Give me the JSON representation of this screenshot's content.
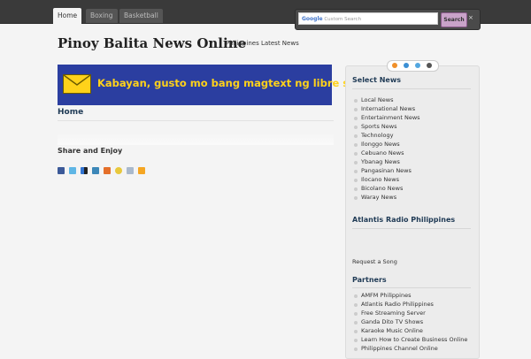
{
  "nav": {
    "tabs": [
      {
        "label": "Home"
      },
      {
        "label": "Boxing"
      },
      {
        "label": "Basketball"
      }
    ]
  },
  "search": {
    "google_label": "Google",
    "placeholder": "Custom Search",
    "button_label": "Search",
    "close_glyph": "×"
  },
  "header": {
    "title": "Pinoy Balita News Online",
    "tagline": "Philippines Latest News"
  },
  "banner": {
    "text": "Kabayan, gusto mo bang magtext ng libre sa pinas?",
    "icon": "envelope-icon"
  },
  "main": {
    "heading": "Home",
    "share_heading": "Share and Enjoy",
    "share_icons": [
      "facebook-icon",
      "twitter-icon",
      "delicious-icon",
      "linkedin-icon",
      "stumbleupon-icon",
      "favorite-icon",
      "email-icon",
      "rss-icon"
    ]
  },
  "sidebar": {
    "top_icons": [
      "rss-icon",
      "share-icon",
      "twitter-icon",
      "bookmark-icon"
    ],
    "select_news": {
      "heading": "Select News",
      "items": [
        "Local News",
        "International News",
        "Entertainment News",
        "Sports News",
        "Technology",
        "Ilonggo News",
        "Cebuano News",
        "Ybanag News",
        "Pangasinan News",
        "Ilocano News",
        "Bicolano News",
        "Waray News"
      ]
    },
    "radio": {
      "heading": "Atlantis Radio Philippines",
      "link": "Request a Song"
    },
    "partners": {
      "heading": "Partners",
      "items": [
        "AMFM Philippines",
        "Atlantis Radio Philippines",
        "Free Streaming Server",
        "Ganda Dito TV Shows",
        "Karaoke Music Online",
        "Learn How to Create Business Online",
        "Philippines Channel Online"
      ]
    }
  },
  "colors": {
    "nav_bg": "#3a3a3a",
    "banner_bg": "#2b3ea0",
    "banner_text": "#ffd21a",
    "heading": "#1f3a55",
    "search_button": "#c9a3c9"
  }
}
